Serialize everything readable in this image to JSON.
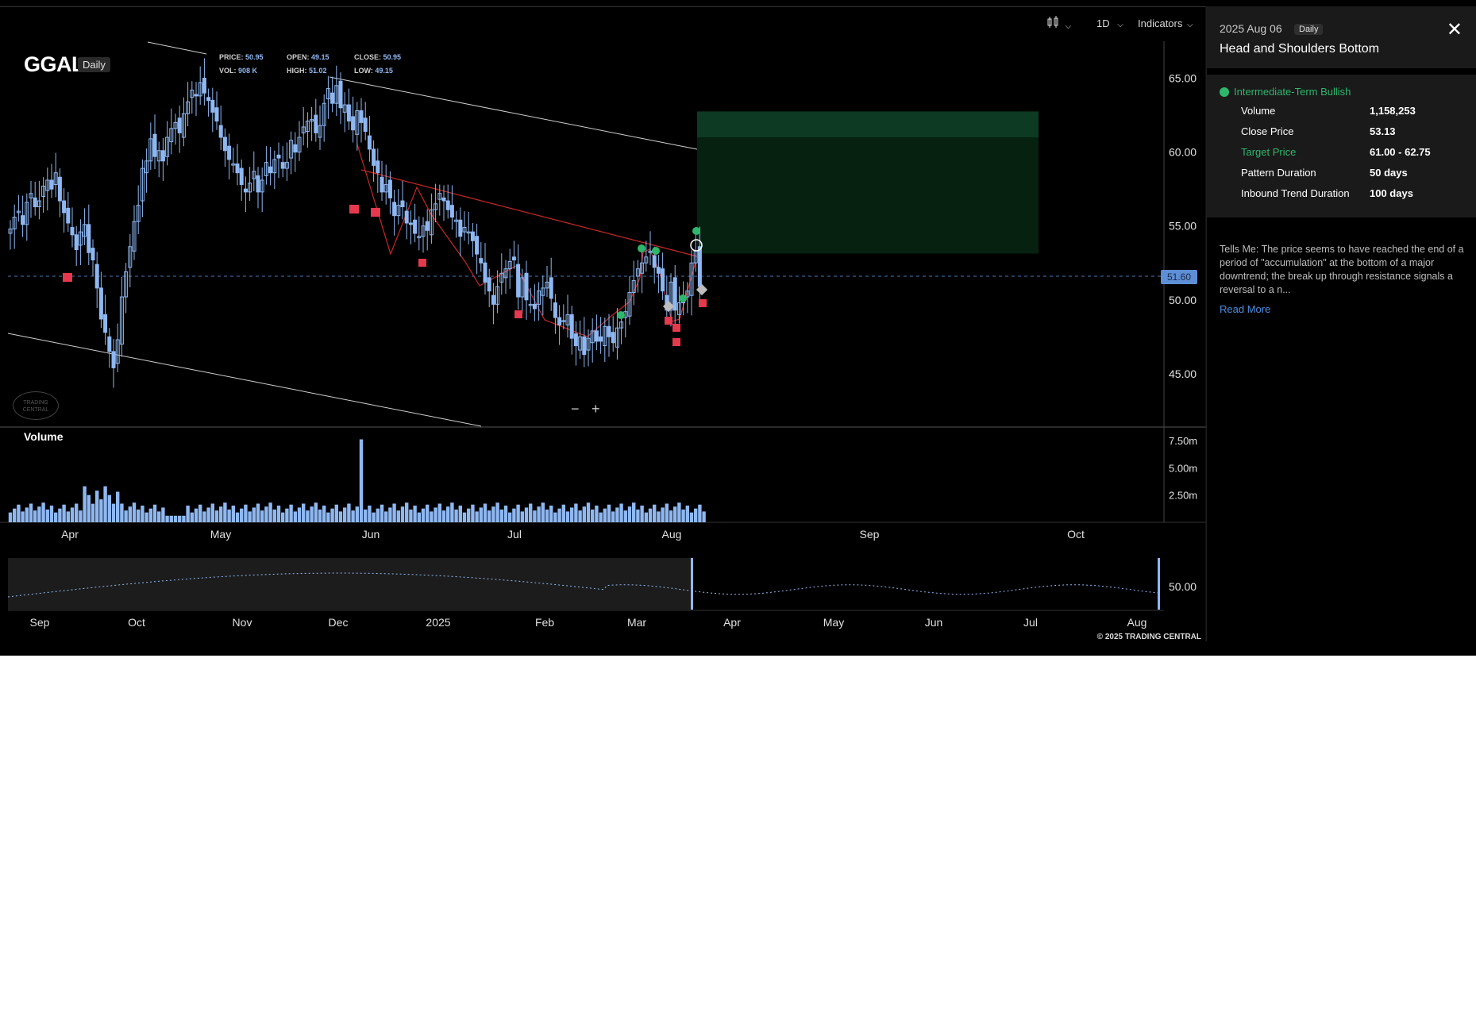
{
  "toolbar": {
    "chart_type_icon": "candlestick-icon",
    "interval": "1D",
    "indicators_label": "Indicators"
  },
  "symbol": {
    "ticker": "GGAL",
    "period": "Daily"
  },
  "ohlc": {
    "price_label": "PRICE:",
    "price": "50.95",
    "open_label": "OPEN:",
    "open": "49.15",
    "close_label": "CLOSE:",
    "close": "50.95",
    "vol_label": "VOL:",
    "vol": "908 K",
    "high_label": "HIGH:",
    "high": "51.02",
    "low_label": "LOW:",
    "low": "49.15"
  },
  "current_price_tag": "51.60",
  "zoom": {
    "minus": "−",
    "plus": "+"
  },
  "watermark": "TRADING CENTRAL",
  "copyright": "© 2025 TRADING CENTRAL",
  "panel": {
    "date": "2025 Aug 06",
    "period": "Daily",
    "title": "Head and Shoulders Bottom",
    "close_icon": "close-icon",
    "signal": "Intermediate-Term Bullish",
    "stats": [
      {
        "label": "Volume",
        "value": "1,158,253",
        "highlight": false
      },
      {
        "label": "Close Price",
        "value": "53.13",
        "highlight": false
      },
      {
        "label": "Target Price",
        "value": "61.00 - 62.75",
        "highlight": true
      },
      {
        "label": "Pattern Duration",
        "value": "50 days",
        "highlight": false
      },
      {
        "label": "Inbound Trend Duration",
        "value": "100 days",
        "highlight": false
      }
    ],
    "tells_me": "Tells Me: The price seems to have reached the end of a period of \"accumulation\" at the bottom of a major downtrend; the break up through resistance signals a reversal to a n...",
    "read_more": "Read More"
  },
  "chart_data": [
    {
      "type": "candlestick",
      "title": "GGAL Daily",
      "y_ticks": [
        65,
        60,
        55,
        50,
        45
      ],
      "y_tick_labels": [
        "65.00",
        "60.00",
        "55.00",
        "50.00",
        "45.00"
      ],
      "ylim": [
        41.5,
        67.5
      ],
      "x_tick_labels": [
        "Apr",
        "May",
        "Jun",
        "Jul",
        "Aug",
        "Sep",
        "Oct"
      ],
      "reference_line": 51.6,
      "target_zone": [
        61.0,
        62.75
      ],
      "zone_lower": 53.13,
      "close": [
        54.8,
        55.6,
        56.0,
        55.1,
        56.6,
        57.2,
        56.3,
        56.7,
        57.7,
        58.1,
        57.5,
        58.6,
        56.7,
        55.9,
        55.2,
        54.4,
        53.4,
        54.6,
        55.1,
        53.2,
        52.7,
        50.8,
        48.7,
        47.8,
        46.5,
        45.4,
        47.3,
        50.2,
        51.9,
        53.6,
        55.3,
        56.4,
        58.9,
        59.4,
        60.9,
        59.7,
        60.1,
        59.4,
        61.0,
        61.6,
        62.0,
        61.3,
        62.6,
        63.4,
        64.2,
        63.8,
        64.7,
        64.0,
        63.5,
        62.7,
        62.1,
        61.0,
        60.1,
        59.5,
        59.2,
        58.6,
        57.8,
        57.3,
        57.9,
        58.7,
        57.3,
        58.1,
        59.3,
        58.6,
        59.5,
        59.6,
        58.9,
        59.3,
        60.8,
        60.0,
        61.0,
        61.7,
        62.1,
        62.2,
        61.3,
        61.8,
        63.3,
        64.3,
        63.3,
        64.5,
        63.0,
        63.2,
        62.1,
        61.5,
        62.8,
        62.0,
        61.4,
        60.2,
        59.1,
        58.6,
        57.3,
        57.8,
        56.9,
        55.7,
        56.4,
        56.3,
        55.2,
        55.1,
        54.5,
        54.3,
        55.0,
        54.7,
        56.1,
        56.5,
        57.2,
        56.7,
        56.1,
        55.6,
        55.4,
        54.3,
        54.9,
        54.6,
        54.0,
        53.1,
        52.5,
        51.2,
        50.6,
        49.7,
        50.9,
        51.8,
        52.1,
        52.6,
        52.7,
        50.2,
        51.5,
        50.0,
        49.7,
        49.4,
        50.6,
        50.8,
        51.2,
        50.1,
        48.8,
        48.3,
        48.6,
        49.0,
        47.4,
        46.9,
        47.5,
        46.3,
        47.4,
        47.9,
        47.2,
        47.2,
        48.2,
        47.5,
        47.1,
        48.1,
        48.5,
        49.2,
        50.5,
        51.3,
        52.1,
        52.5,
        52.9,
        53.3,
        52.2,
        51.8,
        50.6,
        49.3,
        51.2,
        49.3,
        49.8,
        49.9,
        50.6,
        52.5,
        53.3,
        50.9
      ],
      "candles_visible": 169,
      "volume": {
        "label": "Volume",
        "y_tick_labels": [
          "7.50m",
          "5.00m",
          "2.50m"
        ],
        "ylim": [
          0,
          8000000
        ]
      },
      "annotations": [
        "Head and Shoulders Bottom pattern lines",
        "buy/sell signal markers"
      ]
    },
    {
      "type": "line",
      "title": "navigator",
      "x_tick_labels": [
        "Sep",
        "Oct",
        "Nov",
        "Dec",
        "2025",
        "Feb",
        "Mar",
        "Apr",
        "May",
        "Jun",
        "Jul",
        "Aug"
      ],
      "y_tick_labels": [
        "50.00"
      ]
    }
  ]
}
